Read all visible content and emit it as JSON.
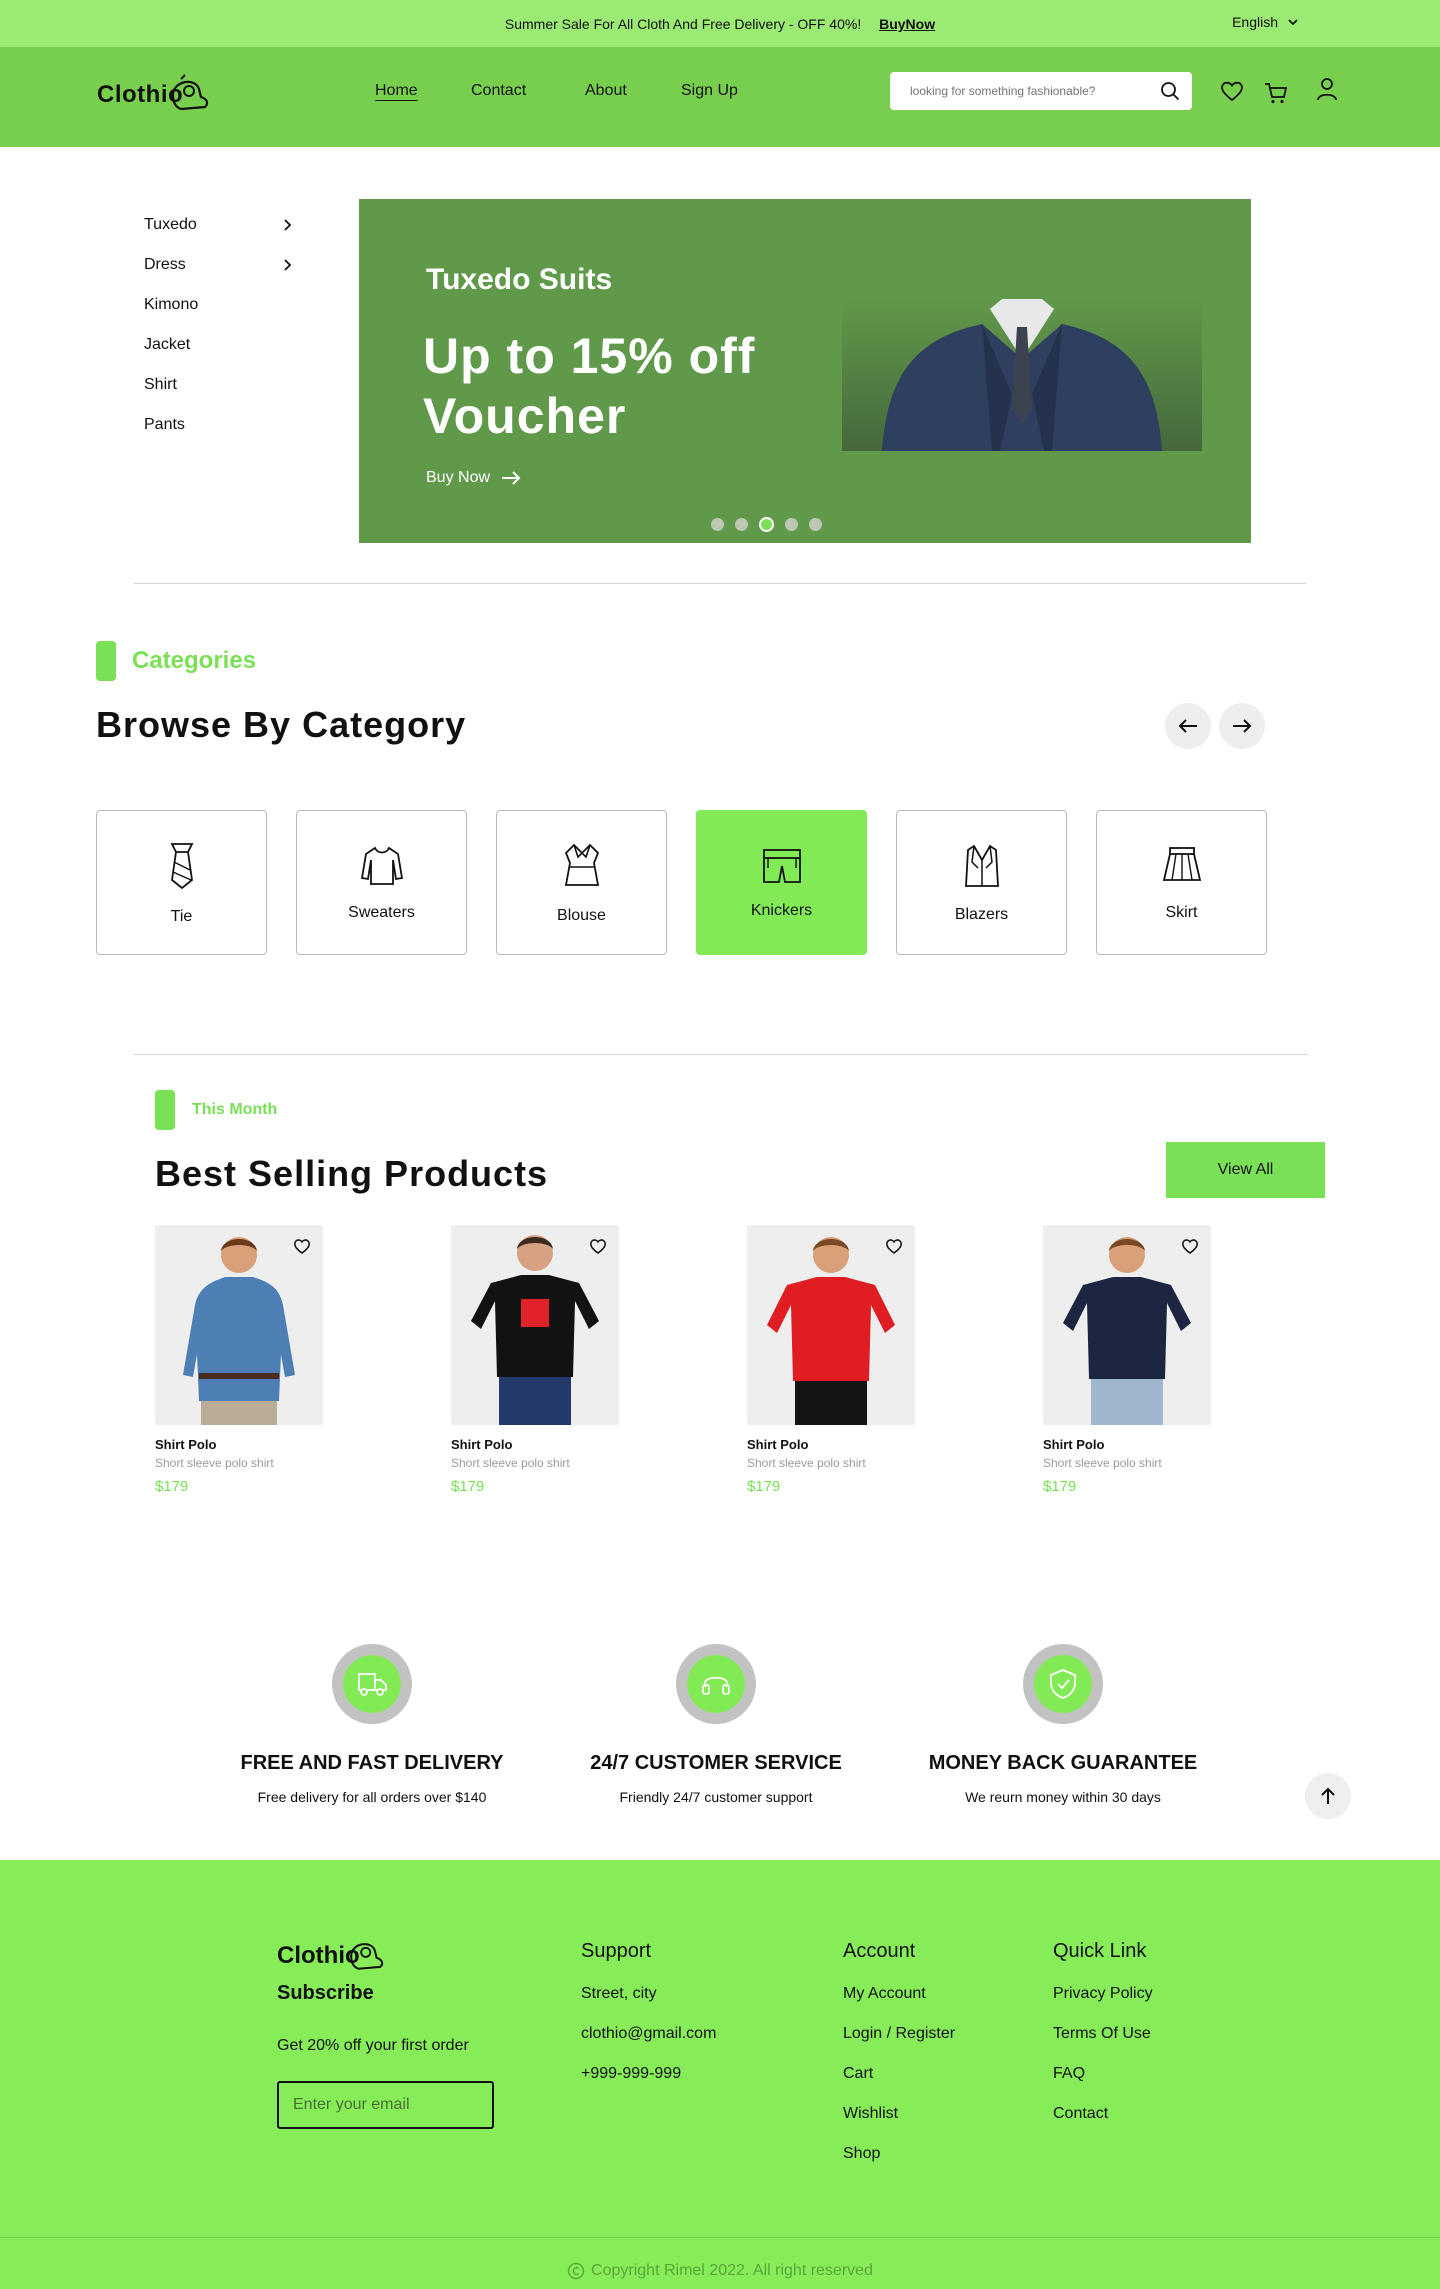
{
  "topbar": {
    "message": "Summer Sale For All Cloth And Free Delivery - OFF 40%!",
    "buy_now": "BuyNow",
    "language": "English"
  },
  "brand": {
    "name": "Clothio"
  },
  "nav": {
    "items": [
      "Home",
      "Contact",
      "About",
      "Sign Up"
    ]
  },
  "search": {
    "placeholder": "looking for something fashionable?"
  },
  "sidebar": {
    "items": [
      "Tuxedo",
      "Dress",
      "Kimono",
      "Jacket",
      "Shirt",
      "Pants"
    ]
  },
  "banner": {
    "subtitle": "Tuxedo Suits",
    "headline": "Up to 15% off Voucher",
    "cta": "Buy Now",
    "active_slide": 3,
    "slide_count": 5
  },
  "categories": {
    "tag": "Categories",
    "title": "Browse By Category",
    "items": [
      "Tie",
      "Sweaters",
      "Blouse",
      "Knickers",
      "Blazers",
      "Skirt"
    ],
    "selected": "Knickers"
  },
  "best_selling": {
    "tag": "This Month",
    "title": "Best Selling Products",
    "view_all": "View All",
    "products": [
      {
        "name": "Shirt Polo",
        "desc": "Short sleeve polo shirt",
        "price": "$179"
      },
      {
        "name": "Shirt Polo",
        "desc": "Short sleeve polo shirt",
        "price": "$179"
      },
      {
        "name": "Shirt Polo",
        "desc": "Short sleeve polo shirt",
        "price": "$179"
      },
      {
        "name": "Shirt Polo",
        "desc": "Short sleeve polo shirt",
        "price": "$179"
      }
    ]
  },
  "services": [
    {
      "title": "FREE AND FAST DELIVERY",
      "desc": "Free delivery for all orders over $140"
    },
    {
      "title": "24/7 CUSTOMER SERVICE",
      "desc": "Friendly 24/7 customer support"
    },
    {
      "title": "MONEY BACK GUARANTEE",
      "desc": "We reurn money within 30 days"
    }
  ],
  "footer": {
    "brand": "Clothio",
    "subscribe": "Subscribe",
    "offer": "Get 20% off your first order",
    "email_placeholder": "Enter your email",
    "support": {
      "title": "Support",
      "items": [
        "Street, city",
        "clothio@gmail.com",
        "+999-999-999"
      ]
    },
    "account": {
      "title": "Account",
      "items": [
        "My Account",
        "Login / Register",
        "Cart",
        "Wishlist",
        "Shop"
      ]
    },
    "quick": {
      "title": "Quick Link",
      "items": [
        "Privacy Policy",
        "Terms Of Use",
        "FAQ",
        "Contact"
      ]
    },
    "copyright": "Copyright Rimel 2022. All right reserved"
  },
  "colors": {
    "accent": "#7ae056",
    "header": "#78cf4d",
    "topbar": "#9bea73",
    "banner": "#61994a",
    "footer": "#86ec57"
  }
}
